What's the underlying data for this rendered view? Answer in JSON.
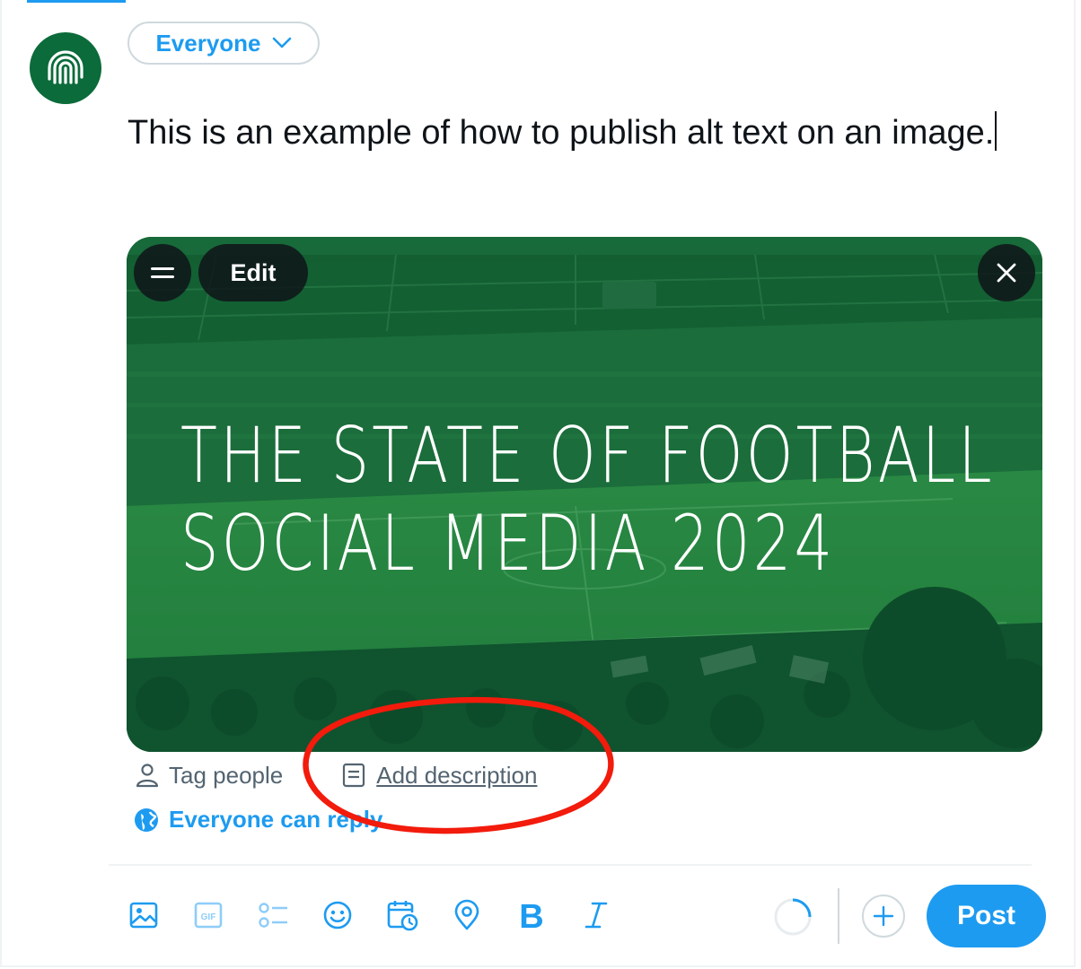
{
  "composer": {
    "audience_label": "Everyone",
    "text": "This is an example of how to publish alt text on an image.",
    "icons": {
      "avatar": "brand-logo-icon",
      "audience_chevron": "chevron-down-icon"
    }
  },
  "media": {
    "title_line1": "THE STATE OF FOOTBALL",
    "title_line2": "SOCIAL MEDIA 2024",
    "edit_label": "Edit",
    "background": "football-stadium-photo",
    "overlay_color": "#0b6b3a",
    "icons": {
      "menu": "menu-icon",
      "close": "close-icon"
    }
  },
  "media_actions": {
    "tag_people_label": "Tag people",
    "add_description_label": "Add description",
    "icons": {
      "tag_people": "person-icon",
      "add_description": "document-icon"
    }
  },
  "reply_setting": {
    "label": "Everyone can reply",
    "icon": "globe-icon"
  },
  "toolbar": {
    "icons": [
      "image-icon",
      "gif-icon",
      "poll-icon",
      "emoji-icon",
      "schedule-icon",
      "location-icon",
      "bold-icon",
      "italic-icon"
    ],
    "add_icon": "plus-icon",
    "post_label": "Post"
  },
  "colors": {
    "accent": "#1d9bf0",
    "annotation": "#f21b0c",
    "text": "#0f1419",
    "muted": "#536471"
  }
}
